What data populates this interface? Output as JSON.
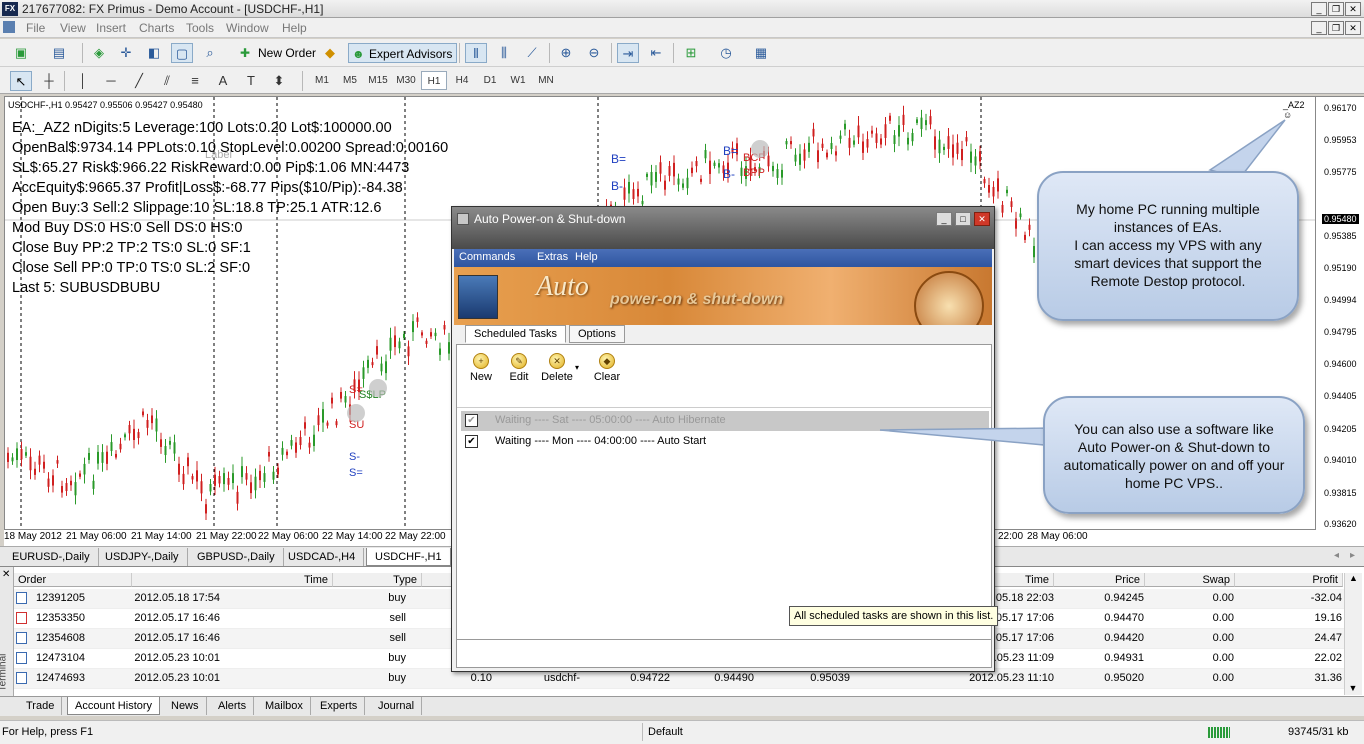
{
  "window": {
    "title": "217677082: FX Primus - Demo Account - [USDCHF-,H1]",
    "logo": "FX"
  },
  "menu": [
    "File",
    "View",
    "Insert",
    "Charts",
    "Tools",
    "Window",
    "Help"
  ],
  "toolbar": {
    "new_order": "New Order",
    "expert_advisors": "Expert Advisors"
  },
  "timeframes": [
    "M1",
    "M5",
    "M15",
    "M30",
    "H1",
    "H4",
    "D1",
    "W1",
    "MN"
  ],
  "chart": {
    "header": "USDCHF-,H1  0.95427 0.95506 0.95427 0.95480",
    "ea_name": "_AZ2 ☺",
    "label": "Label",
    "info_lines": [
      "EA:_AZ2 nDigits:5 Leverage:100 Lots:0.20 Lot$:100000.00",
      "OpenBal$:9734.14 PPLots:0.10 StopLevel:0.00200 Spread:0.00160",
      "SL$:65.27 Risk$:966.22 RiskReward:0.00 Pip$:1.06 MN:4473",
      "AccEquity$:9665.37 Profit|Loss$:-68.77 Pips($10/Pip):-84.38",
      "Open Buy:3 Sell:2 Slippage:10 SL:18.8 TP:25.1 ATR:12.6",
      "Mod Buy DS:0 HS:0 Sell DS:0 HS:0",
      "Close Buy PP:2 TP:2 TS:0 SL:0 SF:1",
      "Close Sell PP:0 TP:0 TS:0 SL:2 SF:0",
      "Last 5: SUBUSDBUBU"
    ],
    "y_labels": [
      "0.96170",
      "0.95953",
      "0.95775",
      "0.95480",
      "0.95385",
      "0.95190",
      "0.94994",
      "0.94795",
      "0.94600",
      "0.94405",
      "0.94205",
      "0.94010",
      "0.93815",
      "0.93620"
    ],
    "current_price": "0.95480",
    "x_labels": [
      "18 May 2012",
      "21 May 06:00",
      "21 May 14:00",
      "21 May 22:00",
      "22 May 06:00",
      "22 May 14:00",
      "22 May 22:00",
      "22:00",
      "28 May 06:00"
    ],
    "markers": {
      "b_eq": "B=",
      "b_minus": "B-",
      "s_eq": "S=",
      "s_minus": "S-",
      "su": "SU",
      "sslp": "S$LP",
      "bcp": "BCP",
      "bpp": "BPP"
    }
  },
  "symbol_tabs": [
    "EURUSD-,Daily",
    "USDJPY-,Daily",
    "GBPUSD-,Daily",
    "USDCAD-,H4",
    "USDCHF-,H1"
  ],
  "terminal": {
    "side_label": "Terminal",
    "headers": {
      "order": "Order",
      "time": "Time",
      "type": "Type",
      "time2": "Time",
      "price": "Price",
      "swap": "Swap",
      "profit": "Profit"
    },
    "rows": [
      {
        "order": "12391205",
        "time": "2012.05.18 17:54",
        "type": "buy",
        "size": "",
        "symbol": "",
        "open": "",
        "sl": "",
        "tp": "",
        "close_time": "2012.05.18 22:03",
        "price": "0.94245",
        "swap": "0.00",
        "profit": "-32.04"
      },
      {
        "order": "12353350",
        "time": "2012.05.17 16:46",
        "type": "sell",
        "size": "",
        "symbol": "",
        "open": "",
        "sl": "",
        "tp": "",
        "close_time": "2012.05.17 17:06",
        "price": "0.94470",
        "swap": "0.00",
        "profit": "19.16"
      },
      {
        "order": "12354608",
        "time": "2012.05.17 16:46",
        "type": "sell",
        "size": "",
        "symbol": "",
        "open": "",
        "sl": "",
        "tp": "",
        "close_time": "2012.05.17 17:06",
        "price": "0.94420",
        "swap": "0.00",
        "profit": "24.47"
      },
      {
        "order": "12473104",
        "time": "2012.05.23 10:01",
        "type": "buy",
        "size": "",
        "symbol": "",
        "open": "",
        "sl": "",
        "tp": "",
        "close_time": "2012.05.23 11:09",
        "price": "0.94931",
        "swap": "0.00",
        "profit": "22.02"
      },
      {
        "order": "12474693",
        "time": "2012.05.23 10:01",
        "type": "buy",
        "size": "0.10",
        "symbol": "usdchf-",
        "open": "0.94722",
        "sl": "0.94490",
        "tp": "0.95039",
        "close_time": "2012.05.23 11:10",
        "price": "0.95020",
        "swap": "0.00",
        "profit": "31.36"
      }
    ]
  },
  "bottom_tabs": [
    "Trade",
    "Account History",
    "News",
    "Alerts",
    "Mailbox",
    "Experts",
    "Journal"
  ],
  "status": {
    "help": "For Help, press F1",
    "profile": "Default",
    "traffic": "93745/31 kb"
  },
  "dialog": {
    "title": "Auto Power-on & Shut-down",
    "menu": [
      "Commands",
      "Extras",
      "Help"
    ],
    "banner_auto": "Auto",
    "banner_sub": "power-on & shut-down",
    "tabs": [
      "Scheduled Tasks",
      "Options"
    ],
    "tools": [
      "New",
      "Edit",
      "Delete",
      "Clear"
    ],
    "tasks": [
      "Waiting ---- Sat  ---- 05:00:00 ---- Auto Hibernate",
      "Waiting ---- Mon  ---- 04:00:00 ---- Auto Start"
    ],
    "tooltip": "All scheduled tasks are shown in this list."
  },
  "callouts": {
    "home_pc": "My home PC running multiple instances of EAs.\nI can access my VPS with any smart devices that support the Remote Destop protocol.",
    "software": "You can also use a software like Auto Power-on & Shut-down to automatically power on and off your home PC VPS.."
  }
}
